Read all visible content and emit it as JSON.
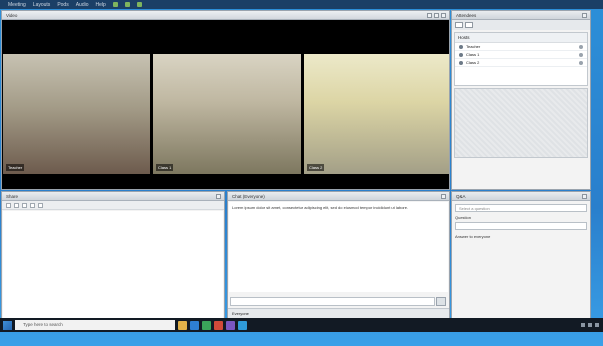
{
  "menubar": {
    "items": [
      "Meeting",
      "Layouts",
      "Pods",
      "Audio",
      "Help"
    ]
  },
  "pods": {
    "video": {
      "title": "Video"
    },
    "attendees": {
      "title": "Attendees",
      "group_label": "Hosts",
      "attendees": [
        "Teacher",
        "Class 1",
        "Class 2"
      ]
    },
    "shared": {
      "title": "Share"
    },
    "chat": {
      "title": "Chat (Everyone)",
      "message": "Lorem ipsum dolor sit amet, consectetur adipiscing elit, sed do eiusmod tempor incididunt ut labore.",
      "foot": "Everyone"
    },
    "notes": {
      "title": "Q&A",
      "select_placeholder": "Select a question",
      "label": "Question",
      "note_text": "Answer to everyone"
    }
  },
  "video_tiles": [
    {
      "name": "Teacher"
    },
    {
      "name": "Class 1"
    },
    {
      "name": "Class 2"
    }
  ],
  "taskbar": {
    "search_placeholder": "Type here to search"
  },
  "colors": {
    "desktop": "#2a7fcc",
    "pod_bg": "#f3f3f3",
    "video_bg": "#000000",
    "taskbar": "#121a24"
  }
}
